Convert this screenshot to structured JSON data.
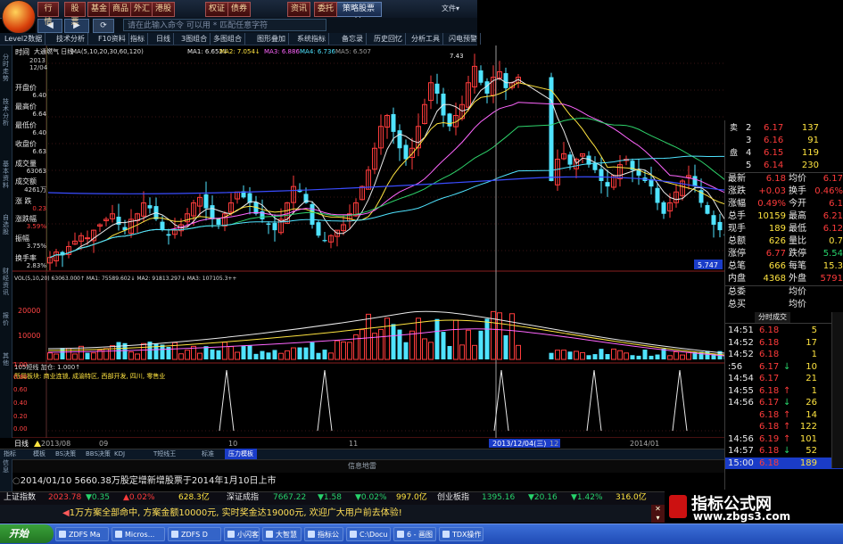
{
  "toolbar": {
    "buttons": [
      "行情",
      "股票",
      "基金",
      "商品",
      "外汇",
      "港股",
      "权证",
      "债券",
      "资讯",
      "委托"
    ],
    "special": "策略股票池",
    "cmd_placeholder": "请在此输入命令 可以用 * 匹配任意字符",
    "file_menu": "文件▾"
  },
  "menu": [
    "Level2数据",
    "技术分析",
    "F10资料",
    "指标",
    "日线",
    "3图组合",
    "多图组合",
    "图形叠加",
    "系统指标",
    "备忘录",
    "历史回忆",
    "分析工具",
    "闪电预警"
  ],
  "sidebar_tabs": [
    "分时走势",
    "技术分析",
    "基本资料",
    "自选股",
    "财经资讯",
    "报价",
    "其他"
  ],
  "info_panel": {
    "header": "时间",
    "date": "2013",
    "date2": "12/04",
    "rows": [
      {
        "label": "开盘价",
        "value": "6.40"
      },
      {
        "label": "最高价",
        "value": "6.64"
      },
      {
        "label": "最低价",
        "value": "6.40"
      },
      {
        "label": "收盘价",
        "value": "6.63"
      },
      {
        "label": "成交量",
        "value": "63063"
      },
      {
        "label": "成交额",
        "value": "4261万"
      },
      {
        "label": "涨 跌",
        "value": "0.23"
      },
      {
        "label": "涨跌幅",
        "value": "3.59%"
      },
      {
        "label": "振幅",
        "value": "3.75%"
      },
      {
        "label": "换手率",
        "value": "2.83%"
      }
    ]
  },
  "chart_header": {
    "name": "大通燃气 日线",
    "ma_text": "MA(5,10,20,30,60,120)",
    "ma1": "MA1: 6.652↓",
    "ma2": "MA2: 7.054↓",
    "ma3": "MA3: 6.886",
    "ma4": "MA4: 6.736",
    "ma5": "MA5: 6.507",
    "high_label": "7.43",
    "price_tag": "5.747"
  },
  "volume_header": {
    "text": "VOL(5,10,20) 63063.000↑ MA1: 75589.602↓ MA2: 91813.297↓ MA3: 107105.3++",
    "ticks": [
      "20000",
      "10000"
    ]
  },
  "indicator_header": {
    "line1": "105短线 加仓: 1.000↑",
    "line2": "所属板块: 商业连锁, 成渝特区, 西部开发, 四川, 零售业",
    "ticks": [
      "1.00",
      "0.80",
      "0.60",
      "0.40",
      "0.20",
      "0.00"
    ]
  },
  "time_axis": [
    "日线",
    "2013/08",
    "09",
    "10",
    "11",
    "2013/12/04(三)",
    "12",
    "2014/01"
  ],
  "bottom_tabs": [
    "指标",
    "模板",
    "BS决策",
    "BBS决策",
    "KDJ",
    "T短线王",
    "标准",
    "压力模板"
  ],
  "news_bar": "信息地雷",
  "notice": "2014/01/10 5660.38万股定增新增股票于2014年1月10日上市",
  "right_panel": {
    "asks": [
      {
        "label": "卖",
        "level": "2",
        "price": "6.17",
        "vol": "137"
      },
      {
        "label": "",
        "level": "3",
        "price": "6.16",
        "vol": "91"
      },
      {
        "label": "盘",
        "level": "4",
        "price": "6.15",
        "vol": "119"
      },
      {
        "label": "",
        "level": "5",
        "price": "6.14",
        "vol": "230"
      }
    ],
    "stats": [
      [
        "最新",
        "6.18",
        "均价",
        "6.17"
      ],
      [
        "涨跌",
        "+0.03",
        "换手",
        "0.46%"
      ],
      [
        "涨幅",
        "0.49%",
        "今开",
        "6.1"
      ],
      [
        "总手",
        "10159",
        "最高",
        "6.21"
      ],
      [
        "现手",
        "189",
        "最低",
        "6.12"
      ],
      [
        "总额",
        "626",
        "量比",
        "0.7"
      ],
      [
        "涨停",
        "6.77",
        "跌停",
        "5.54"
      ],
      [
        "总笔",
        "666",
        "每笔",
        "15.3"
      ],
      [
        "内盘",
        "4368",
        "外盘",
        "5791"
      ]
    ],
    "extra": [
      [
        "总委",
        "",
        "均价",
        ""
      ],
      [
        "总买",
        "",
        "均价",
        ""
      ]
    ],
    "trades_title": "分时成交",
    "trades": [
      {
        "time": "14:51",
        "price": "6.18",
        "vol": "5",
        "dir": ""
      },
      {
        "time": "14:52",
        "price": "6.18",
        "vol": "17",
        "dir": ""
      },
      {
        "time": "14:52",
        "price": "6.18",
        "vol": "1",
        "dir": ""
      },
      {
        "time": ":56",
        "price": "6.17",
        "vol": "10",
        "dir": "↓"
      },
      {
        "time": "14:54",
        "price": "6.17",
        "vol": "21",
        "dir": ""
      },
      {
        "time": "14:55",
        "price": "6.18",
        "vol": "1",
        "dir": "↑"
      },
      {
        "time": "14:56",
        "price": "6.17",
        "vol": "26",
        "dir": "↓"
      },
      {
        "time": "",
        "price": "6.18",
        "vol": "14",
        "dir": "↑"
      },
      {
        "time": "",
        "price": "6.18",
        "vol": "122",
        "dir": "↑"
      },
      {
        "time": "14:56",
        "price": "6.19",
        "vol": "101",
        "dir": "↑"
      },
      {
        "time": "14:57",
        "price": "6.18",
        "vol": "52",
        "dir": "↓"
      },
      {
        "time": "15:00",
        "price": "6.18",
        "vol": "189",
        "dir": ""
      }
    ]
  },
  "index_bar": [
    {
      "name": "上证指数",
      "value": "2023.78",
      "change": "▼0.35",
      "pct": "▲0.02%",
      "amount": "628.3亿"
    },
    {
      "name": "深证成指",
      "value": "7667.22",
      "change": "▼1.58",
      "pct": "▼0.02%",
      "amount": "997.0亿"
    },
    {
      "name": "创业板指",
      "value": "1395.16",
      "change": "▼20.16",
      "pct": "▼1.42%",
      "amount": "316.0亿"
    }
  ],
  "ad_bar": "1万方案全部命中, 方案金额10000元, 实时奖金达19000元, 欢迎广大用户前去体验!",
  "taskbar": {
    "start": "开始",
    "items": [
      "ZDFS Ma",
      "Micros...",
      "ZDFS D",
      "小闪客",
      "大智慧",
      "指标公",
      "C:\\Docu",
      "6 - 画图",
      "TDX操作"
    ]
  },
  "watermark": {
    "title": "指标公式网",
    "url": "www.zbgs3.com"
  }
}
